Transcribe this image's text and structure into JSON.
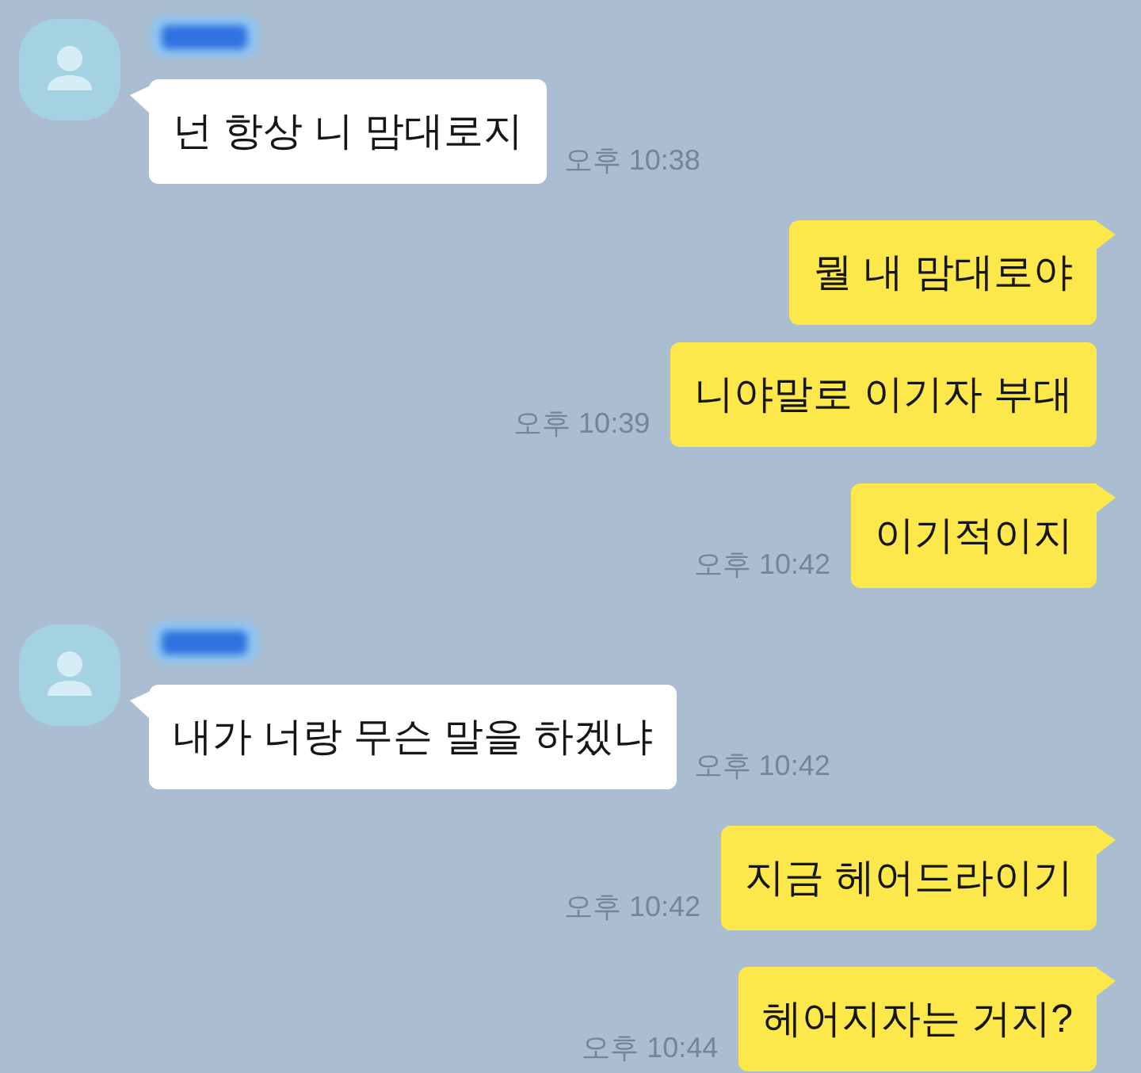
{
  "chat": {
    "messages": [
      {
        "kind": "incoming",
        "redacted_name": true,
        "tail": true,
        "text": "넌 항상 니 맘대로지",
        "time": "오후 10:38"
      },
      {
        "kind": "outgoing",
        "tail": true,
        "text": "뭘 내 맘대로야"
      },
      {
        "kind": "outgoing",
        "tail": false,
        "text": "니야말로 이기자 부대",
        "time": "오후 10:39"
      },
      {
        "kind": "outgoing",
        "tail": true,
        "text": "이기적이지",
        "time": "오후 10:42"
      },
      {
        "kind": "incoming",
        "redacted_name": true,
        "tail": true,
        "text": "내가 너랑 무슨 말을 하겠냐",
        "time": "오후 10:42"
      },
      {
        "kind": "outgoing",
        "tail": true,
        "text": "지금 헤어드라이기",
        "time": "오후 10:42"
      },
      {
        "kind": "outgoing",
        "tail": true,
        "text": "헤어지자는 거지?",
        "time": "오후 10:44"
      }
    ]
  }
}
